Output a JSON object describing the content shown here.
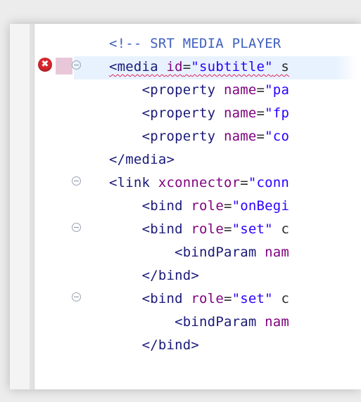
{
  "editor": {
    "lines": [
      {
        "id": "comment",
        "indent": "",
        "fold": false,
        "error": false,
        "segments": [
          {
            "c": "comment",
            "t": "<!-- SRT MEDIA PLAYER"
          }
        ]
      },
      {
        "id": "media-open",
        "indent": "",
        "fold": true,
        "error": true,
        "current": true,
        "segments": [
          {
            "c": "tag",
            "t": "<media"
          },
          {
            "c": "plain",
            "t": " "
          },
          {
            "c": "attr",
            "t": "id"
          },
          {
            "c": "plain",
            "t": "="
          },
          {
            "c": "str",
            "t": "\"subtitle\""
          },
          {
            "c": "plain",
            "t": " s"
          }
        ]
      },
      {
        "id": "property-1",
        "indent": "    ",
        "fold": false,
        "error": false,
        "segments": [
          {
            "c": "tag",
            "t": "<property"
          },
          {
            "c": "plain",
            "t": " "
          },
          {
            "c": "attr",
            "t": "name"
          },
          {
            "c": "plain",
            "t": "="
          },
          {
            "c": "str",
            "t": "\"pa"
          }
        ]
      },
      {
        "id": "property-2",
        "indent": "    ",
        "fold": false,
        "error": false,
        "segments": [
          {
            "c": "tag",
            "t": "<property"
          },
          {
            "c": "plain",
            "t": " "
          },
          {
            "c": "attr",
            "t": "name"
          },
          {
            "c": "plain",
            "t": "="
          },
          {
            "c": "str",
            "t": "\"fp"
          }
        ]
      },
      {
        "id": "property-3",
        "indent": "    ",
        "fold": false,
        "error": false,
        "segments": [
          {
            "c": "tag",
            "t": "<property"
          },
          {
            "c": "plain",
            "t": " "
          },
          {
            "c": "attr",
            "t": "name"
          },
          {
            "c": "plain",
            "t": "="
          },
          {
            "c": "str",
            "t": "\"co"
          }
        ]
      },
      {
        "id": "media-close",
        "indent": "",
        "fold": false,
        "error": false,
        "segments": [
          {
            "c": "tag",
            "t": "</media>"
          }
        ]
      },
      {
        "id": "link-open",
        "indent": "",
        "fold": true,
        "error": false,
        "segments": [
          {
            "c": "tag",
            "t": "<link"
          },
          {
            "c": "plain",
            "t": " "
          },
          {
            "c": "attr",
            "t": "xconnector"
          },
          {
            "c": "plain",
            "t": "="
          },
          {
            "c": "str",
            "t": "\"conn"
          }
        ]
      },
      {
        "id": "bind-onbegin",
        "indent": "    ",
        "fold": false,
        "error": false,
        "segments": [
          {
            "c": "tag",
            "t": "<bind"
          },
          {
            "c": "plain",
            "t": " "
          },
          {
            "c": "attr",
            "t": "role"
          },
          {
            "c": "plain",
            "t": "="
          },
          {
            "c": "str",
            "t": "\"onBegi"
          }
        ]
      },
      {
        "id": "bind-set-1",
        "indent": "    ",
        "fold": true,
        "error": false,
        "segments": [
          {
            "c": "tag",
            "t": "<bind"
          },
          {
            "c": "plain",
            "t": " "
          },
          {
            "c": "attr",
            "t": "role"
          },
          {
            "c": "plain",
            "t": "="
          },
          {
            "c": "str",
            "t": "\"set\""
          },
          {
            "c": "plain",
            "t": " c"
          }
        ]
      },
      {
        "id": "bindparam-1",
        "indent": "        ",
        "fold": false,
        "error": false,
        "segments": [
          {
            "c": "tag",
            "t": "<bindParam"
          },
          {
            "c": "plain",
            "t": " "
          },
          {
            "c": "attr",
            "t": "nam"
          }
        ]
      },
      {
        "id": "bind-close-1",
        "indent": "    ",
        "fold": false,
        "error": false,
        "segments": [
          {
            "c": "tag",
            "t": "</bind>"
          }
        ]
      },
      {
        "id": "bind-set-2",
        "indent": "    ",
        "fold": true,
        "error": false,
        "segments": [
          {
            "c": "tag",
            "t": "<bind"
          },
          {
            "c": "plain",
            "t": " "
          },
          {
            "c": "attr",
            "t": "role"
          },
          {
            "c": "plain",
            "t": "="
          },
          {
            "c": "str",
            "t": "\"set\""
          },
          {
            "c": "plain",
            "t": " c"
          }
        ]
      },
      {
        "id": "bindparam-2",
        "indent": "        ",
        "fold": false,
        "error": false,
        "segments": [
          {
            "c": "tag",
            "t": "<bindParam"
          },
          {
            "c": "plain",
            "t": " "
          },
          {
            "c": "attr",
            "t": "nam"
          }
        ]
      },
      {
        "id": "bind-close-2",
        "indent": "    ",
        "fold": false,
        "error": false,
        "segments": [
          {
            "c": "tag",
            "t": "</bind>"
          }
        ]
      }
    ]
  },
  "colors": {
    "tag": "#1a1a7a",
    "attribute": "#7f007f",
    "string": "#2a00ff",
    "comment": "#3f5fbf",
    "error": "#d8262f",
    "current_line": "#e8f2fe"
  },
  "icons": {
    "error": "error-icon",
    "fold": "collapse-fold-icon"
  }
}
